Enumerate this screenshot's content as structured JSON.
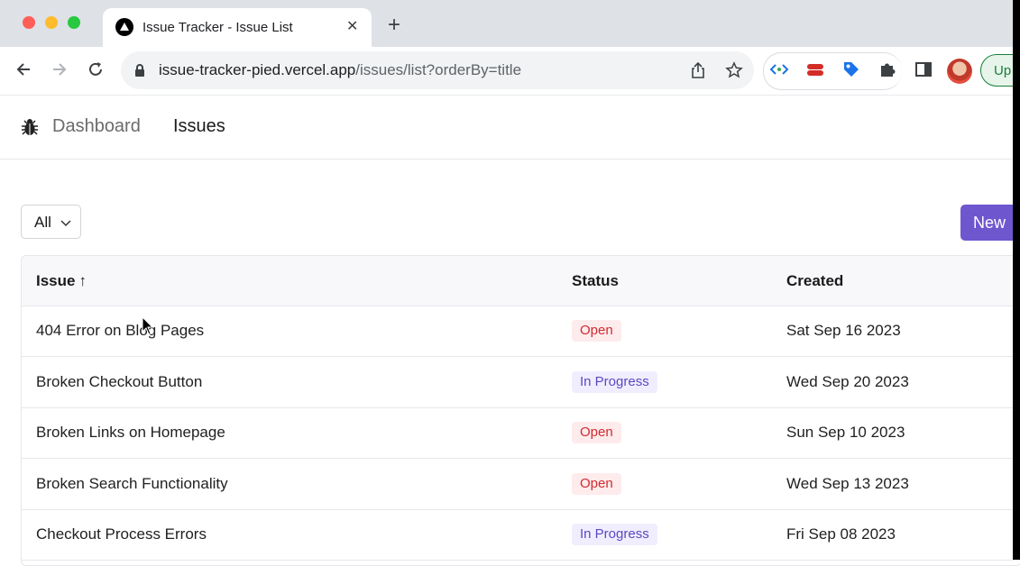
{
  "browser": {
    "tab_title": "Issue Tracker - Issue List",
    "url_host": "issue-tracker-pied.vercel.app",
    "url_path": "/issues/list?orderBy=title",
    "update_label": "Up"
  },
  "nav": {
    "dashboard": "Dashboard",
    "issues": "Issues"
  },
  "filter": {
    "selected": "All"
  },
  "new_button": "New",
  "table": {
    "headers": {
      "issue": "Issue",
      "status": "Status",
      "created": "Created"
    },
    "rows": [
      {
        "title": "404 Error on Blog Pages",
        "status": "Open",
        "created": "Sat Sep 16 2023"
      },
      {
        "title": "Broken Checkout Button",
        "status": "In Progress",
        "created": "Wed Sep 20 2023"
      },
      {
        "title": "Broken Links on Homepage",
        "status": "Open",
        "created": "Sun Sep 10 2023"
      },
      {
        "title": "Broken Search Functionality",
        "status": "Open",
        "created": "Wed Sep 13 2023"
      },
      {
        "title": "Checkout Process Errors",
        "status": "In Progress",
        "created": "Fri Sep 08 2023"
      }
    ]
  },
  "colors": {
    "accent": "#6e56cf",
    "open_bg": "#feebec",
    "open_text": "#ce2c31",
    "progress_bg": "#f0eefe",
    "progress_text": "#5b48c2"
  }
}
